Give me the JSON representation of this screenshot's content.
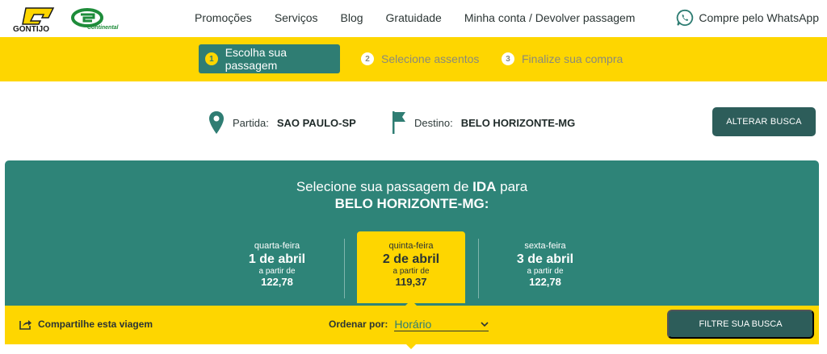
{
  "header": {
    "logo_gontijo": "GONTIJO",
    "logo_continental": "Continental",
    "nav": [
      "Promoções",
      "Serviços",
      "Blog",
      "Gratuidade",
      "Minha conta / Devolver passagem"
    ],
    "whatsapp_label": "Compre pelo WhatsApp",
    "whatsapp_icon": "whatsapp-icon"
  },
  "steps": [
    {
      "num": "1",
      "label": "Escolha sua passagem",
      "active": true
    },
    {
      "num": "2",
      "label": "Selecione assentos",
      "active": false
    },
    {
      "num": "3",
      "label": "Finalize sua compra",
      "active": false
    }
  ],
  "route": {
    "origin_label": "Partida:",
    "origin_value": "SAO PAULO-SP",
    "dest_label": "Destino:",
    "dest_value": "BELO HORIZONTE-MG",
    "alter_button": "ALTERAR BUSCA"
  },
  "panel": {
    "title_prefix": "Selecione sua passagem de ",
    "title_bold": "IDA",
    "title_suffix": " para",
    "destination": "BELO HORIZONTE-MG:",
    "dates": [
      {
        "weekday": "quarta-feira",
        "day": "1 de abril",
        "from": "a partir de",
        "price": "122,78",
        "selected": false
      },
      {
        "weekday": "quinta-feira",
        "day": "2 de abril",
        "from": "a partir de",
        "price": "119,37",
        "selected": true
      },
      {
        "weekday": "sexta-feira",
        "day": "3 de abril",
        "from": "a partir de",
        "price": "122,78",
        "selected": false
      }
    ]
  },
  "bottombar": {
    "share_label": "Compartilhe esta viagem",
    "order_label": "Ordenar por:",
    "order_value": "Horário",
    "filter_button": "FILTRE SUA BUSCA"
  },
  "colors": {
    "yellow": "#fed600",
    "teal": "#2e8478",
    "dark_teal": "#2d5d5a"
  }
}
